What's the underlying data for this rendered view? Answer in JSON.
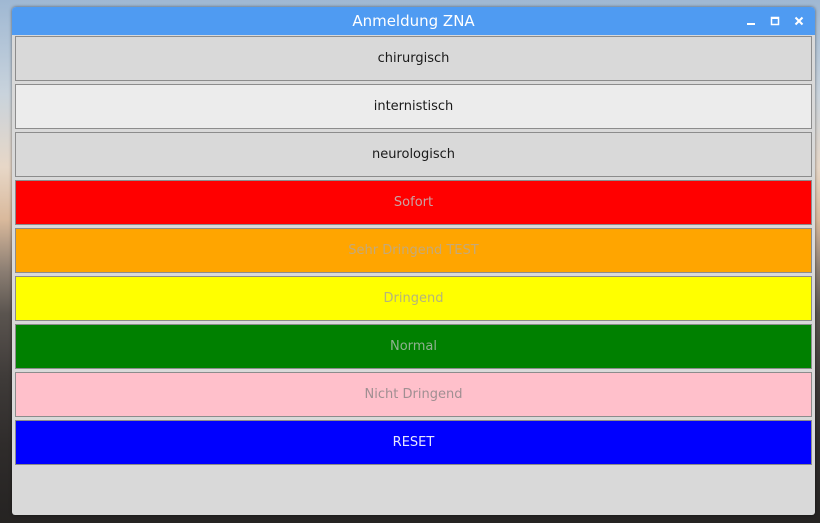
{
  "window": {
    "title": "Anmeldung ZNA",
    "titlebar_color": "#4f9bf2",
    "controls": [
      {
        "icon": "minimize-icon"
      },
      {
        "icon": "maximize-icon"
      },
      {
        "icon": "close-icon"
      }
    ]
  },
  "buttons": [
    {
      "id": "chirurgisch",
      "label": "chirurgisch",
      "bg": "#d9d9d9",
      "fg": "#1a1a1a"
    },
    {
      "id": "internistisch",
      "label": "internistisch",
      "bg": "#ececec",
      "fg": "#1a1a1a"
    },
    {
      "id": "neurologisch",
      "label": "neurologisch",
      "bg": "#d9d9d9",
      "fg": "#1a1a1a"
    },
    {
      "id": "sofort",
      "label": "Sofort",
      "bg": "#ff0000",
      "fg": "#c9a3a3"
    },
    {
      "id": "sehr-dringend",
      "label": "Sehr Dringend TEST",
      "bg": "#ffa500",
      "fg": "#c4a97a"
    },
    {
      "id": "dringend",
      "label": "Dringend",
      "bg": "#ffff00",
      "fg": "#b5b57a"
    },
    {
      "id": "normal",
      "label": "Normal",
      "bg": "#008000",
      "fg": "#8fb08f"
    },
    {
      "id": "nicht-dringend",
      "label": "Nicht Dringend",
      "bg": "#ffc0cb",
      "fg": "#a08f92"
    },
    {
      "id": "reset",
      "label": "RESET",
      "bg": "#0000ff",
      "fg": "#e6e6ff"
    }
  ]
}
